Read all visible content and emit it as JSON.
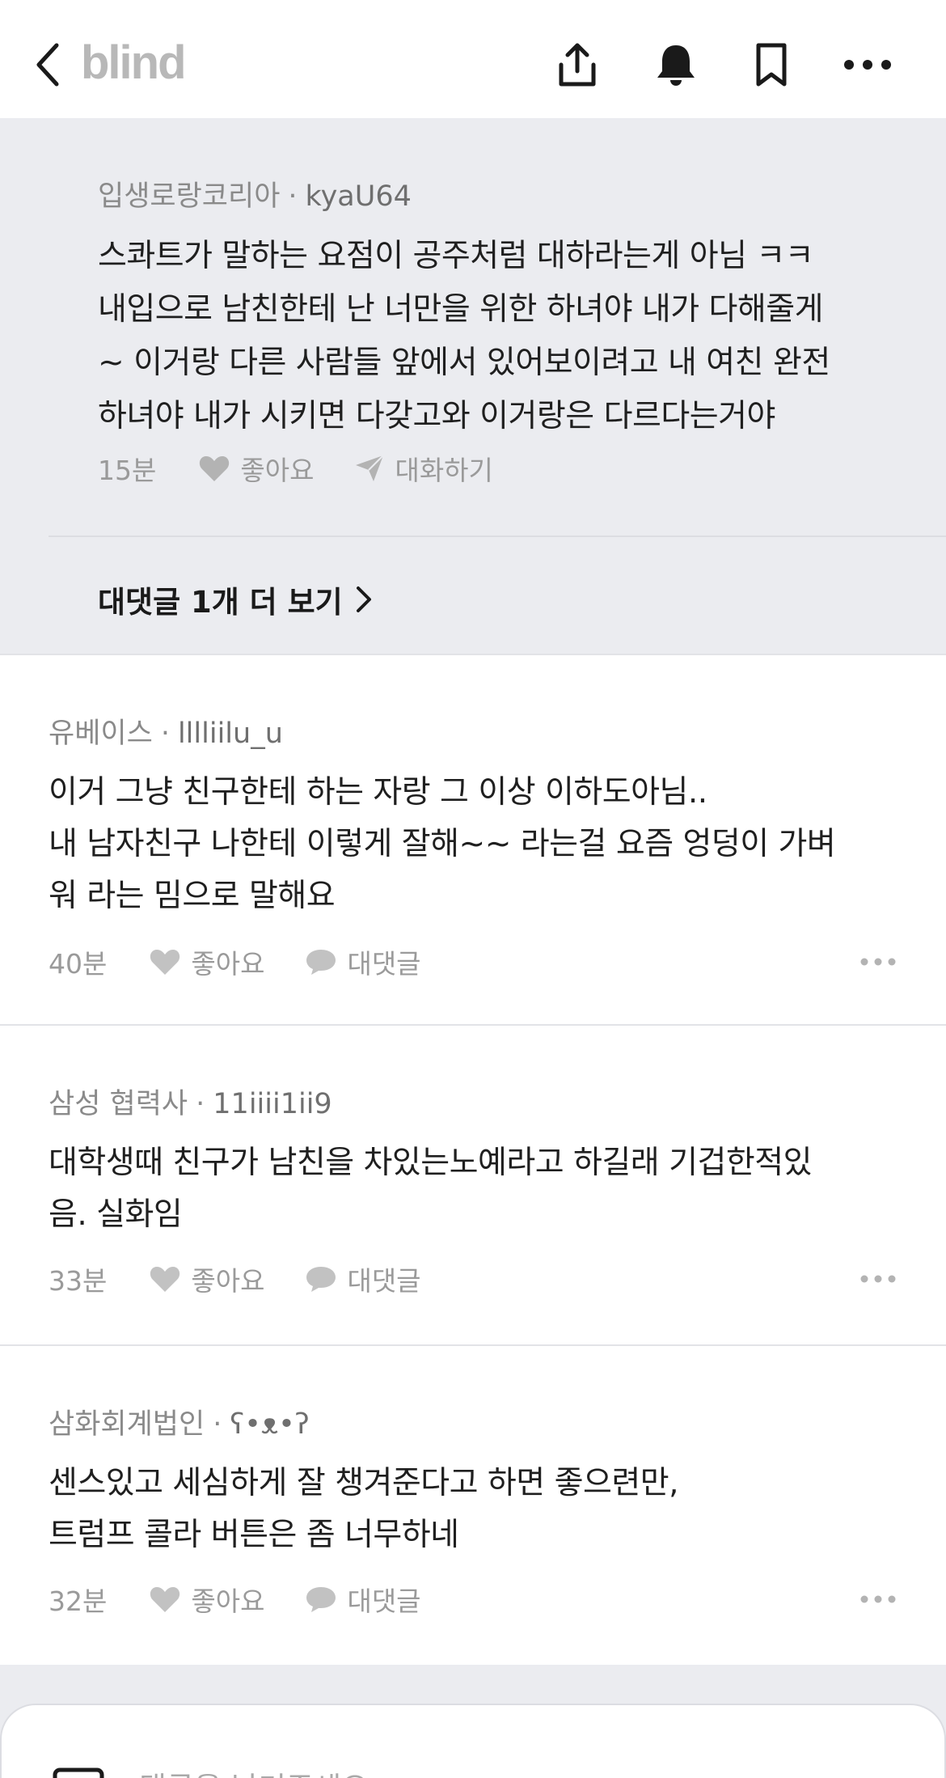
{
  "header": {
    "logo": "blind",
    "icons": [
      "back-icon",
      "share-icon",
      "bell-icon",
      "bookmark-icon",
      "more-icon"
    ]
  },
  "reply": {
    "company": "입생로랑코리아",
    "separator": "·",
    "user": "kyaU64",
    "body": "스콰트가 말하는 요점이 공주처럼 대하라는게 아님 ㅋㅋ\n내입으로 남친한테 난 너만을 위한 하녀야 내가 다해줄게\n~ 이거랑 다른 사람들 앞에서 있어보이려고 내 여친 완전\n하녀야 내가 시키면 다갖고와 이거랑은 다르다는거야",
    "time": "15분",
    "like_label": "좋아요",
    "chat_label": "대화하기"
  },
  "more_replies_label": "대댓글 1개 더 보기",
  "comments": [
    {
      "company": "유베이스",
      "user": "lllliilu_u",
      "body": "이거 그냥 친구한테 하는 자랑 그 이상 이하도아님..\n내 남자친구 나한테 이렇게 잘해~~ 라는걸 요즘 엉덩이 가벼\n워 라는 밈으로 말해요",
      "time": "40분",
      "like_label": "좋아요",
      "reply_label": "대댓글"
    },
    {
      "company": "삼성 협력사",
      "user": "11iiii1ii9",
      "body": "대학생때 친구가 남친을 차있는노예라고 하길래 기겁한적있\n음. 실화임",
      "time": "33분",
      "like_label": "좋아요",
      "reply_label": "대댓글"
    },
    {
      "company": "삼화회계법인",
      "user": "ʕ•ᴥ•ʔ",
      "body": "센스있고 세심하게 잘 챙겨준다고 하면 좋으련만,\n트럼프 콜라 버튼은 좀 너무하네",
      "time": "32분",
      "like_label": "좋아요",
      "reply_label": "대댓글"
    }
  ],
  "input": {
    "placeholder": "댓글을 남겨주세요."
  },
  "colors": {
    "accent_gray": "#ebecf0",
    "meta_text": "#8a8a8a",
    "logo": "#b8b8b8"
  }
}
